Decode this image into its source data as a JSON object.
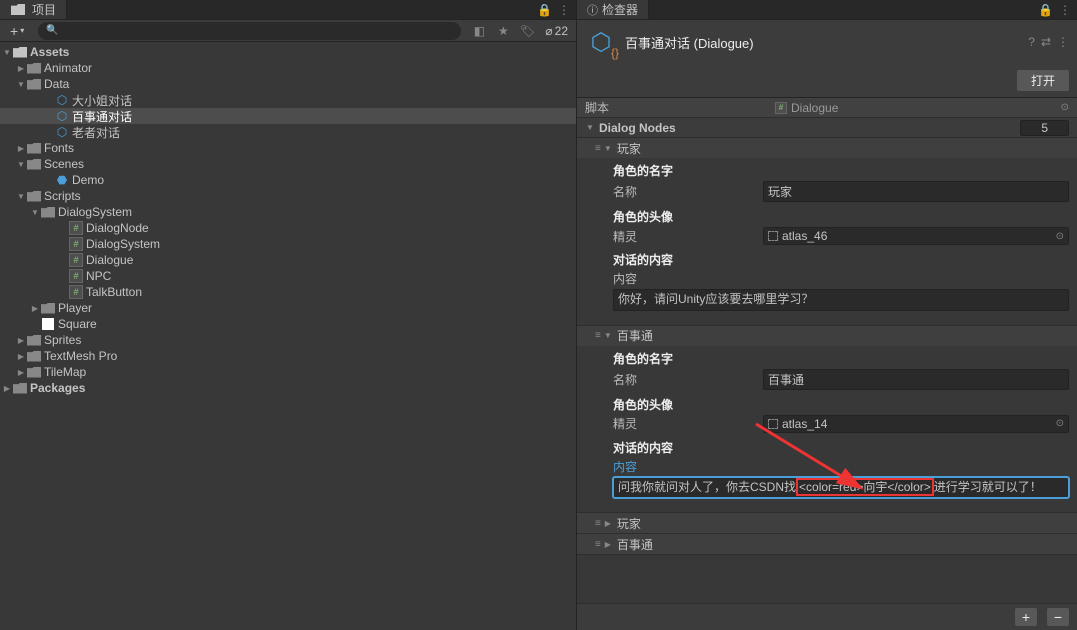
{
  "project": {
    "tab_label": "项目",
    "add_label": "+",
    "search_placeholder": "",
    "visibility_count": "22",
    "tree": {
      "assets": "Assets",
      "animator": "Animator",
      "data": "Data",
      "data_items": [
        "大小姐对话",
        "百事通对话",
        "老者对话"
      ],
      "fonts": "Fonts",
      "scenes": "Scenes",
      "demo": "Demo",
      "scripts": "Scripts",
      "dialogsystem": "DialogSystem",
      "dialog_scripts": [
        "DialogNode",
        "DialogSystem",
        "Dialogue",
        "NPC",
        "TalkButton"
      ],
      "player": "Player",
      "square": "Square",
      "sprites": "Sprites",
      "textmeshpro": "TextMesh Pro",
      "tilemap": "TileMap",
      "packages": "Packages"
    }
  },
  "inspector": {
    "tab_label": "检查器",
    "asset_name": "百事通对话 (Dialogue)",
    "open_label": "打开",
    "script_label": "脚本",
    "script_value": "Dialogue",
    "dialog_nodes_label": "Dialog Nodes",
    "dialog_nodes_count": "5",
    "nodes": [
      {
        "header": "玩家",
        "expanded": true,
        "role_name_section": "角色的名字",
        "name_label": "名称",
        "name_value": "玩家",
        "avatar_section": "角色的头像",
        "sprite_label": "精灵",
        "sprite_value": "atlas_46",
        "content_section": "对话的内容",
        "content_label": "内容",
        "content_value": "你好，请问Unity应该要去哪里学习？"
      },
      {
        "header": "百事通",
        "expanded": true,
        "role_name_section": "角色的名字",
        "name_label": "名称",
        "name_value": "百事通",
        "avatar_section": "角色的头像",
        "sprite_label": "精灵",
        "sprite_value": "atlas_14",
        "content_section": "对话的内容",
        "content_label": "内容",
        "content_label_link": true,
        "content_value_pre": "问我你就问对人了，你去CSDN找",
        "content_value_hl": "<color=red>向宇</color>",
        "content_value_post": "进行学习就可以了！"
      },
      {
        "header": "玩家",
        "expanded": false
      },
      {
        "header": "百事通",
        "expanded": false
      }
    ]
  }
}
